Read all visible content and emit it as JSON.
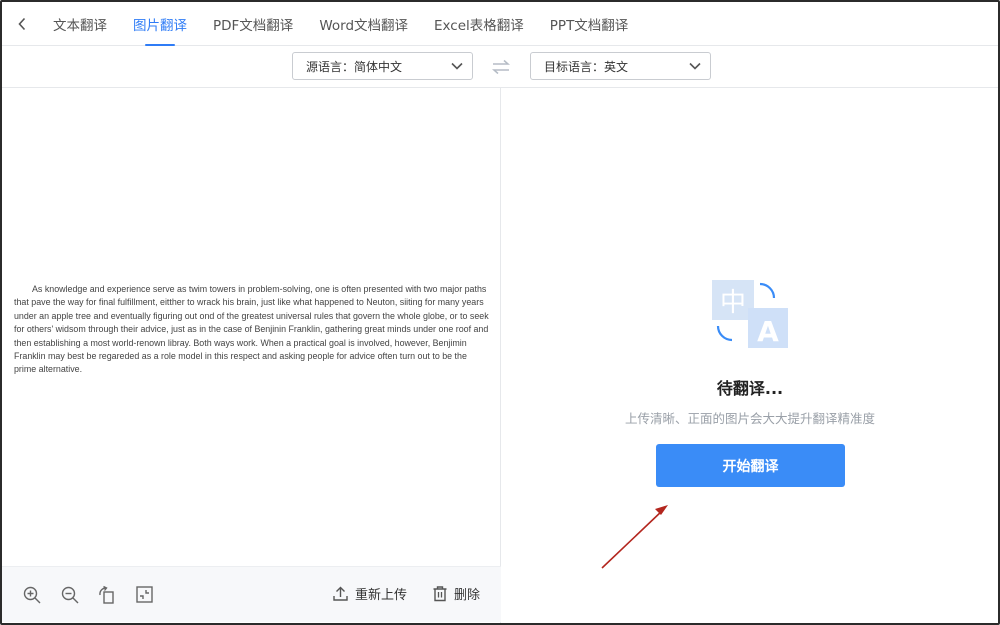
{
  "tabs": [
    {
      "label": "文本翻译",
      "active": false
    },
    {
      "label": "图片翻译",
      "active": true
    },
    {
      "label": "PDF文档翻译",
      "active": false
    },
    {
      "label": "Word文档翻译",
      "active": false
    },
    {
      "label": "Excel表格翻译",
      "active": false
    },
    {
      "label": "PPT文档翻译",
      "active": false
    }
  ],
  "language": {
    "source_label": "源语言：简体中文",
    "target_label": "目标语言：英文"
  },
  "document": {
    "text": "As knowledge and experience serve as twim towers in problem-solving, one is often presented with two major paths that pave the way for final fulfillment, eitther to wrack his brain, just like what happened to Neuton, siiting for many years under an apple tree and eventually figuring out ond of the greatest universal rules that govern the whole globe, or to seek for others' widsom through their advice, just as in the case of Benjinin Franklin, gathering great minds under one roof and then establishing a most world-renown libray. Both ways work. When a practical goal is involved, however, Benjimin Franklin may best be regareded as a role model in this respect and asking people for advice often turn out to be the prime alternative."
  },
  "toolbar": {
    "reupload_label": "重新上传",
    "delete_label": "删除"
  },
  "result": {
    "status_title": "待翻译...",
    "hint": "上传清晰、正面的图片会大大提升翻译精准度",
    "start_label": "开始翻译",
    "illus_zh": "中",
    "illus_en": "A"
  },
  "colors": {
    "accent": "#2f7cf6",
    "button": "#3a8cf7",
    "annotation_arrow": "#b3261e"
  }
}
